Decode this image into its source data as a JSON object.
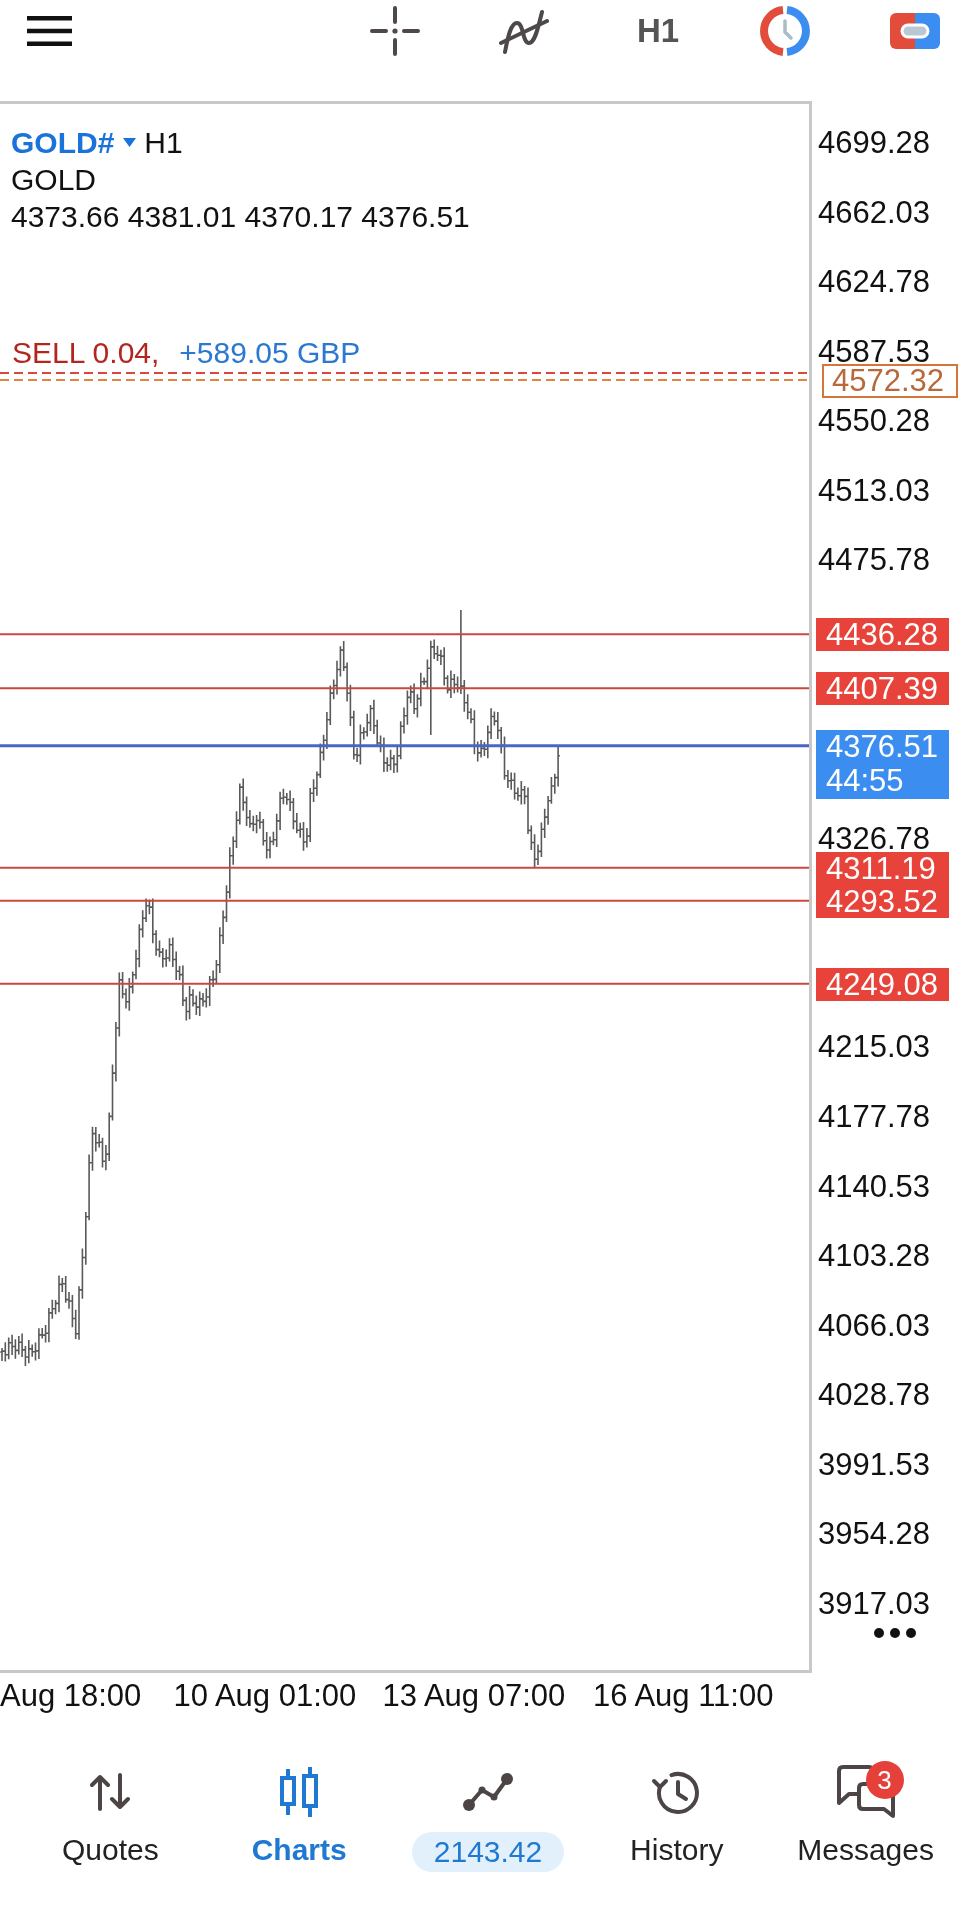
{
  "toolbar": {
    "timeframe": "H1"
  },
  "chart": {
    "symbol": "GOLD#",
    "timeframe": "H1",
    "description": "GOLD",
    "ohlc": "4373.66 4381.01 4370.17 4376.51",
    "position": {
      "label": "SELL 0.04,",
      "profit": "+589.05 GBP"
    },
    "levels": [
      {
        "kind": "stop_loss",
        "price": "4572.32"
      },
      {
        "kind": "level",
        "price": "4436.28"
      },
      {
        "kind": "level",
        "price": "4407.39"
      },
      {
        "kind": "bid",
        "price": "4376.51",
        "countdown": "44:55"
      },
      {
        "kind": "level",
        "price": "4311.19"
      },
      {
        "kind": "level",
        "price": "4293.52"
      },
      {
        "kind": "level",
        "price": "4249.08"
      }
    ],
    "price_axis": [
      "4699.28",
      "4662.03",
      "4624.78",
      "4587.53",
      "4550.28",
      "4513.03",
      "4475.78",
      "4326.78",
      "4215.03",
      "4177.78",
      "4140.53",
      "4103.28",
      "4066.03",
      "4028.78",
      "3991.53",
      "3954.28",
      "3917.03"
    ],
    "time_axis": [
      "Aug 18:00",
      "10 Aug 01:00",
      "13 Aug 07:00",
      "16 Aug 11:00"
    ]
  },
  "nav": [
    {
      "kind": "tab",
      "label": "Quotes",
      "selected": false
    },
    {
      "kind": "tab",
      "label": "Charts",
      "selected": true
    },
    {
      "kind": "balance",
      "value": "2143.42",
      "selected": false
    },
    {
      "kind": "tab",
      "label": "History",
      "selected": false
    },
    {
      "kind": "tab",
      "label": "Messages",
      "selected": false,
      "badge": "3"
    }
  ]
}
